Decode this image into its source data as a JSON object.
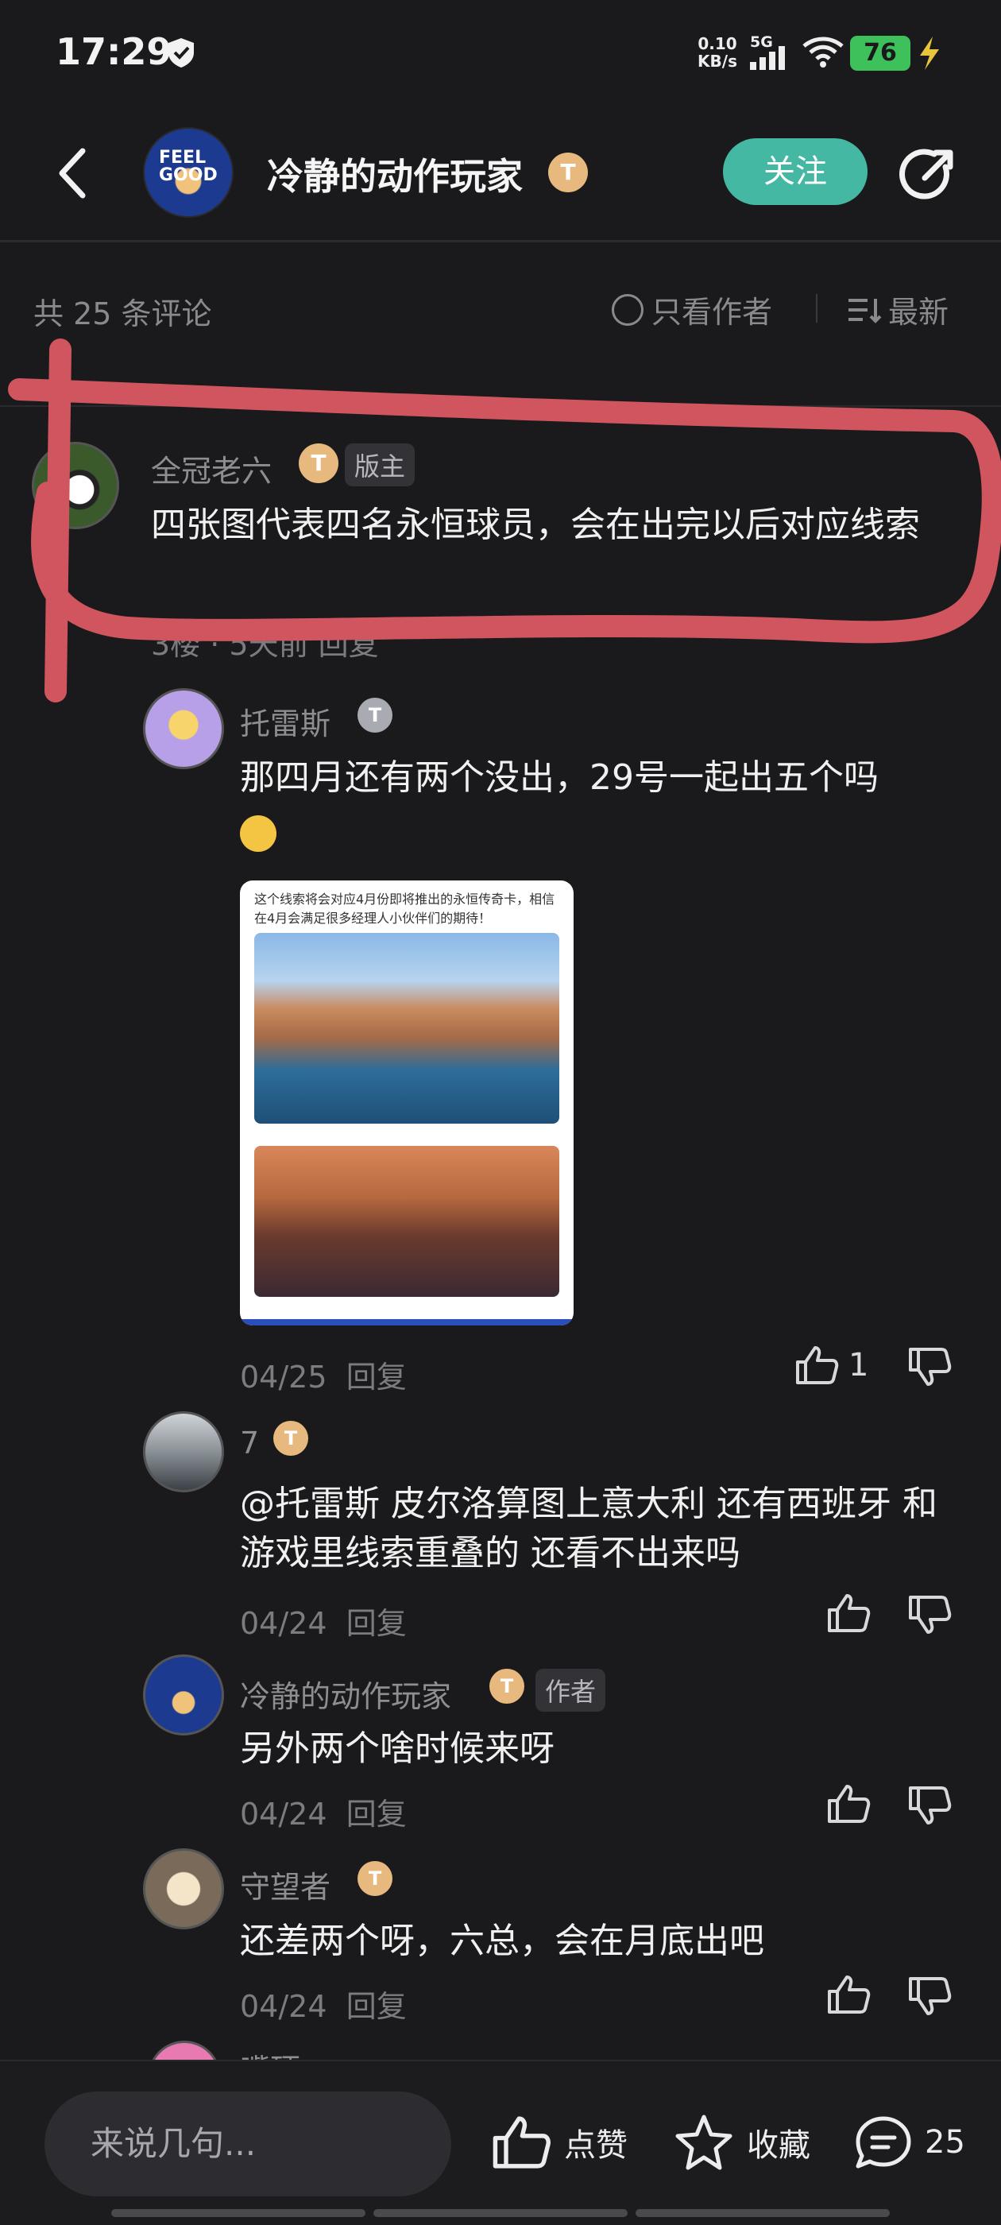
{
  "status_bar": {
    "time": "17:29",
    "net_speed_value": "0.10",
    "net_speed_unit": "KB/s",
    "network": "5G",
    "battery": "76"
  },
  "header": {
    "title": "冷静的动作玩家",
    "badge": "T",
    "follow_label": "关注",
    "avatar_text": "FEEL GOOD"
  },
  "toolbar": {
    "comment_count": "共 25 条评论",
    "only_author_label": "只看作者",
    "sort_label": "最新"
  },
  "comments": [
    {
      "author": "全冠老六",
      "badge": "T",
      "tag": "版主",
      "text": "四张图代表四名永恒球员，会在出完以后对应线索",
      "meta": "3楼 · 5天前  回复"
    }
  ],
  "replies": [
    {
      "author": "托雷斯",
      "badge": "T",
      "text": "那四月还有两个没出，29号一起出五个吗",
      "image_caption": "这个线索将会对应4月份即将推出的永恒传奇卡，相信在4月会满足很多经理人小伙伴们的期待！",
      "date": "04/25",
      "reply_label": "回复",
      "likes": "1"
    },
    {
      "author": "7",
      "badge": "T",
      "text": "@托雷斯  皮尔洛算图上意大利 还有西班牙 和游戏里线索重叠的 还看不出来吗",
      "date": "04/24",
      "reply_label": "回复"
    },
    {
      "author": "冷静的动作玩家",
      "badge": "T",
      "tag": "作者",
      "text": "另外两个啥时候来呀",
      "date": "04/24",
      "reply_label": "回复"
    },
    {
      "author": "守望者",
      "badge": "T",
      "text": "还差两个呀，六总，会在月底出吧",
      "date": "04/24",
      "reply_label": "回复"
    },
    {
      "author": "嘴硬"
    }
  ],
  "bottom_bar": {
    "input_placeholder": "来说几句...",
    "like_label": "点赞",
    "favorite_label": "收藏",
    "comment_count": "25"
  },
  "colors": {
    "background": "#1a1a1c",
    "follow_button": "#44b8a3",
    "annotation": "#d0555e",
    "badge_gold": "#e8b97e",
    "battery": "#3ec15a"
  }
}
